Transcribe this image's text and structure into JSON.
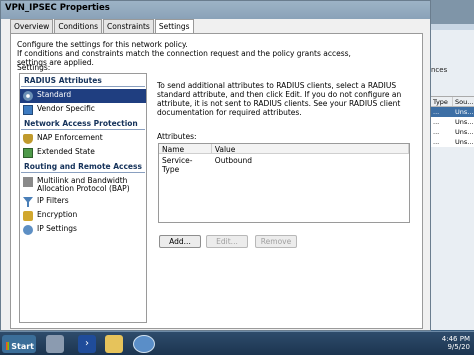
{
  "background_window": {
    "partial_text": "nces",
    "grid_headers": [
      "Type",
      "Sou..."
    ],
    "grid_rows": [
      [
        "...",
        "Uns..."
      ],
      [
        "...",
        "Uns..."
      ],
      [
        "...",
        "Uns..."
      ],
      [
        "...",
        "Uns..."
      ]
    ]
  },
  "dialog": {
    "title": "VPN_IPSEC Properties",
    "tabs": [
      "Overview",
      "Conditions",
      "Constraints",
      "Settings"
    ],
    "active_tab": "Settings",
    "intro_line1": "Configure the settings for this network policy.",
    "intro_line2": "If conditions and constraints match the connection request and the policy grants access, settings are applied.",
    "settings_label": "Settings:",
    "nav": {
      "sections": [
        {
          "heading": "RADIUS Attributes",
          "items": [
            {
              "label": "Standard",
              "icon": "gear-icon",
              "selected": true
            },
            {
              "label": "Vendor Specific",
              "icon": "book-icon",
              "selected": false
            }
          ]
        },
        {
          "heading": "Network Access Protection",
          "items": [
            {
              "label": "NAP Enforcement",
              "icon": "shield-icon",
              "selected": false
            },
            {
              "label": "Extended State",
              "icon": "extended-state-icon",
              "selected": false
            }
          ]
        },
        {
          "heading": "Routing and Remote Access",
          "items": [
            {
              "label": "Multilink and Bandwidth Allocation Protocol (BAP)",
              "icon": "bandwidth-icon",
              "selected": false
            },
            {
              "label": "IP Filters",
              "icon": "filter-icon",
              "selected": false
            },
            {
              "label": "Encryption",
              "icon": "lock-icon",
              "selected": false
            },
            {
              "label": "IP Settings",
              "icon": "network-icon",
              "selected": false
            }
          ]
        }
      ]
    },
    "description": "To send additional attributes to RADIUS clients, select a RADIUS standard attribute, and then click Edit. If you do not configure an attribute, it is not sent to RADIUS clients. See your RADIUS client documentation for required attributes.",
    "attributes_label": "Attributes:",
    "attributes_columns": [
      "Name",
      "Value"
    ],
    "attributes_rows": [
      [
        "Service-Type",
        "Outbound"
      ]
    ],
    "buttons": {
      "add": "Add...",
      "edit": "Edit...",
      "remove": "Remove"
    }
  },
  "taskbar": {
    "start_label": "Start",
    "clock_time": "4:46 PM",
    "clock_date": "9/5/20"
  }
}
